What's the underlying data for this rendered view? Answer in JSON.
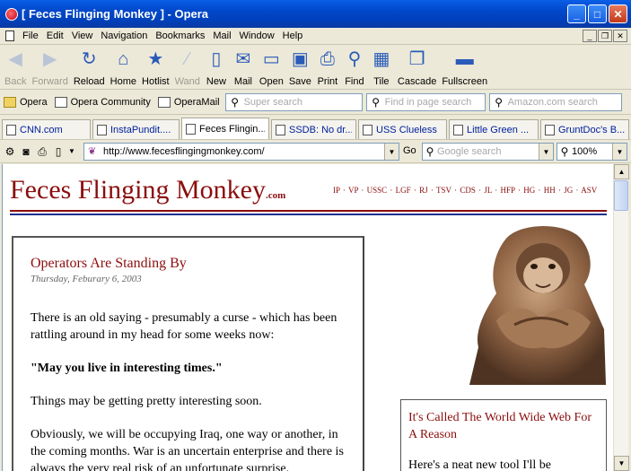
{
  "window": {
    "title": "[ Feces Flinging Monkey ] - Opera"
  },
  "menu": [
    "File",
    "Edit",
    "View",
    "Navigation",
    "Bookmarks",
    "Mail",
    "Window",
    "Help"
  ],
  "toolbar": [
    {
      "label": "Back",
      "icon": "back-arrow-icon",
      "glyph": "◀",
      "disabled": true
    },
    {
      "label": "Forward",
      "icon": "forward-arrow-icon",
      "glyph": "▶",
      "disabled": true
    },
    {
      "label": "Reload",
      "icon": "reload-icon",
      "glyph": "↻",
      "disabled": false
    },
    {
      "label": "Home",
      "icon": "home-icon",
      "glyph": "⌂",
      "disabled": false
    },
    {
      "label": "Hotlist",
      "icon": "star-icon",
      "glyph": "★",
      "disabled": false
    },
    {
      "label": "Wand",
      "icon": "wand-icon",
      "glyph": "⁄",
      "disabled": true
    },
    {
      "label": "New",
      "icon": "new-page-icon",
      "glyph": "▯",
      "disabled": false
    },
    {
      "label": "Mail",
      "icon": "mail-icon",
      "glyph": "✉",
      "disabled": false
    },
    {
      "label": "Open",
      "icon": "open-folder-icon",
      "glyph": "▭",
      "disabled": false
    },
    {
      "label": "Save",
      "icon": "save-icon",
      "glyph": "▣",
      "disabled": false
    },
    {
      "label": "Print",
      "icon": "print-icon",
      "glyph": "⎙",
      "disabled": false
    },
    {
      "label": "Find",
      "icon": "find-icon",
      "glyph": "⚲",
      "disabled": false
    },
    {
      "label": "Tile",
      "icon": "tile-icon",
      "glyph": "▦",
      "disabled": false
    },
    {
      "label": "Cascade",
      "icon": "cascade-icon",
      "glyph": "❐",
      "disabled": false
    },
    {
      "label": "Fullscreen",
      "icon": "fullscreen-icon",
      "glyph": "▬",
      "disabled": false
    }
  ],
  "personal_bar": {
    "links": [
      "Opera",
      "Opera Community",
      "OperaMail"
    ],
    "super_search_placeholder": "Super search",
    "find_in_page_placeholder": "Find in page search",
    "amazon_placeholder": "Amazon.com search"
  },
  "tabs": [
    {
      "label": "CNN.com",
      "active": false
    },
    {
      "label": "InstaPundit....",
      "active": false
    },
    {
      "label": "Feces Flingin...",
      "active": true
    },
    {
      "label": "SSDB: No dr...",
      "active": false
    },
    {
      "label": "USS Clueless",
      "active": false
    },
    {
      "label": "Little Green ...",
      "active": false
    },
    {
      "label": "GruntDoc's B...",
      "active": false
    }
  ],
  "address": {
    "url": "http://www.fecesflingingmonkey.com/",
    "go_label": "Go",
    "google_placeholder": "Google search",
    "zoom": "100%"
  },
  "page": {
    "site_title": "Feces Flinging Monkey",
    "site_suffix": ".com",
    "nav_links": "IP · VP · USSC · LGF · RJ · TSV · CDS · JL · HFP · HG · HH · JG · ASV",
    "post": {
      "title": "Operators Are Standing By",
      "date": "Thursday, Feburary 6, 2003",
      "paragraphs": [
        "There is an old saying - presumably a curse - which has been rattling around in my head for some weeks now:",
        "\"May you live in interesting times.\"",
        "Things may be getting pretty interesting soon.",
        "Obviously, we will be occupying Iraq, one way or another, in the coming months. War is an uncertain enterprise and there is always the very real risk of an unfortunate surprise."
      ]
    },
    "sidebar": {
      "title": "It's Called The World Wide Web For A Reason",
      "text": "Here's a neat new tool I'll be"
    }
  },
  "colors": {
    "site_red": "#8b0d0d",
    "rule_blue": "#1b2e8f",
    "titlebar_blue": "#0047c9"
  }
}
